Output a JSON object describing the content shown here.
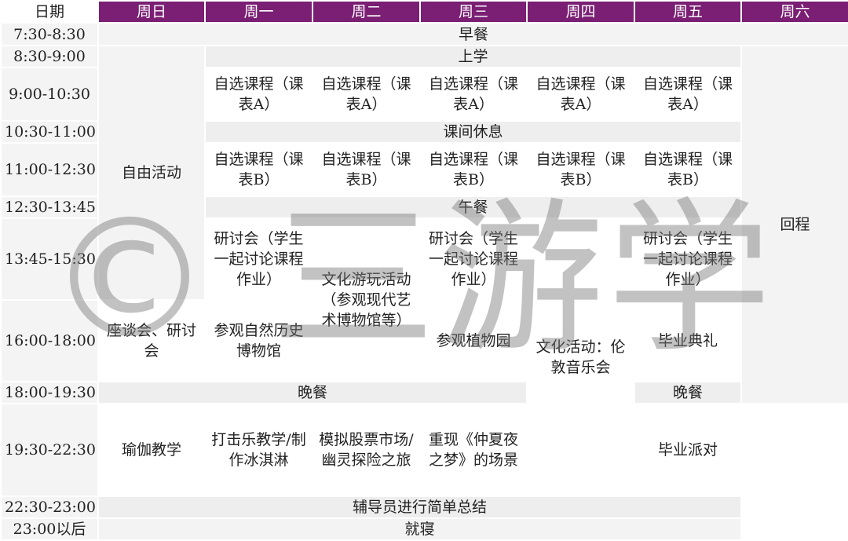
{
  "header": [
    "日期",
    "周日",
    "周一",
    "周二",
    "周三",
    "周四",
    "周五",
    "周六"
  ],
  "times": [
    "7:30-8:30",
    "8:30-9:00",
    "9:00-10:30",
    "10:30-11:00",
    "11:00-12:30",
    "12:30-13:45",
    "13:45-15:30",
    "16:00-18:00",
    "18:00-19:30",
    "19:30-22:30",
    "22:30-23:00",
    "23:00以后"
  ],
  "cells": {
    "breakfast": "早餐",
    "free_activity": "自由活动",
    "return_trip": "回程",
    "class_start": "上学",
    "elective_a": "自选课程（课表A）",
    "break": "课间休息",
    "elective_b": "自选课程（课表B）",
    "lunch": "午餐",
    "seminar": "研讨会（学生一起讨论课程作业）",
    "culture_tour": "文化游玩活动（参观现代艺术博物馆等）",
    "culture_activity": "文化活动：伦敦音乐会",
    "symposium": "座谈会、研讨会",
    "natural_history": "参观自然历史博物馆",
    "botanic": "参观植物园",
    "graduation": "毕业典礼",
    "dinner": "晚餐",
    "yoga": "瑜伽教学",
    "percussion": "打击乐教学/制作冰淇淋",
    "stock_ghost": "模拟股票市场/幽灵探险之旅",
    "midsummer": "重现《仲夏夜之梦》的场景",
    "party": "毕业派对",
    "summary": "辅导员进行简单总结",
    "sleep": "就寝"
  },
  "watermark": "© 三游学"
}
